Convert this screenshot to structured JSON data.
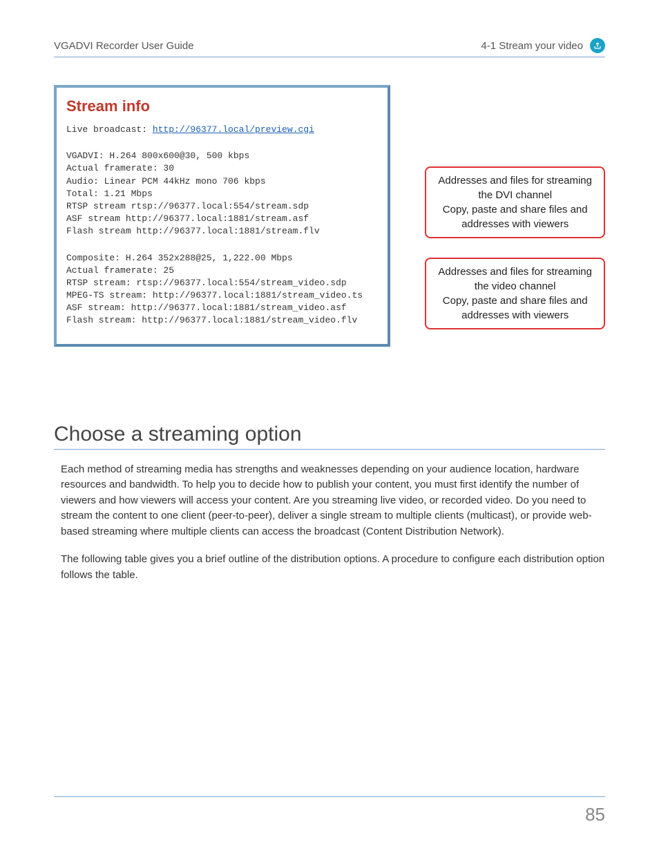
{
  "header": {
    "left": "VGADVI Recorder User Guide",
    "right": "4-1 Stream your video"
  },
  "stream_info": {
    "title": "Stream info",
    "broadcast_label": "Live broadcast: ",
    "broadcast_url": "http://96377.local/preview.cgi",
    "block1": {
      "l1": "VGADVI: H.264 800x600@30, 500 kbps",
      "l2": "Actual framerate: 30",
      "l3": "Audio: Linear PCM 44kHz mono 706 kbps",
      "l4": "Total: 1.21 Mbps",
      "l5": "RTSP stream rtsp://96377.local:554/stream.sdp",
      "l6": "ASF stream http://96377.local:1881/stream.asf",
      "l7": "Flash stream http://96377.local:1881/stream.flv"
    },
    "block2": {
      "l1": "Composite: H.264 352x288@25, 1,222.00 Mbps",
      "l2": "Actual framerate: 25",
      "l3": "RTSP stream: rtsp://96377.local:554/stream_video.sdp",
      "l4": "MPEG-TS stream: http://96377.local:1881/stream_video.ts",
      "l5": "ASF stream: http://96377.local:1881/stream_video.asf",
      "l6": "Flash stream: http://96377.local:1881/stream_video.flv"
    }
  },
  "callouts": {
    "c1": "Addresses and files for streaming the DVI channel\nCopy, paste and share files and addresses with viewers",
    "c2": "Addresses and files for streaming the video channel\nCopy, paste and share files and addresses with viewers"
  },
  "section": {
    "heading": "Choose a streaming option",
    "p1": "Each method of streaming media has strengths and weaknesses depending on your audience location, hardware resources and bandwidth. To help you to decide how to publish your content, you must first identify the number of viewers and how viewers will access your content. Are you streaming live video, or recorded video. Do you need to stream the content to one client (peer-to-peer), deliver a single stream to multiple clients (multicast), or provide web-based streaming where multiple clients can access the broadcast (Content Distribution Network).",
    "p2": "The following table gives you a brief outline of the distribution options. A procedure to configure each distribution option follows the table."
  },
  "page_number": "85"
}
